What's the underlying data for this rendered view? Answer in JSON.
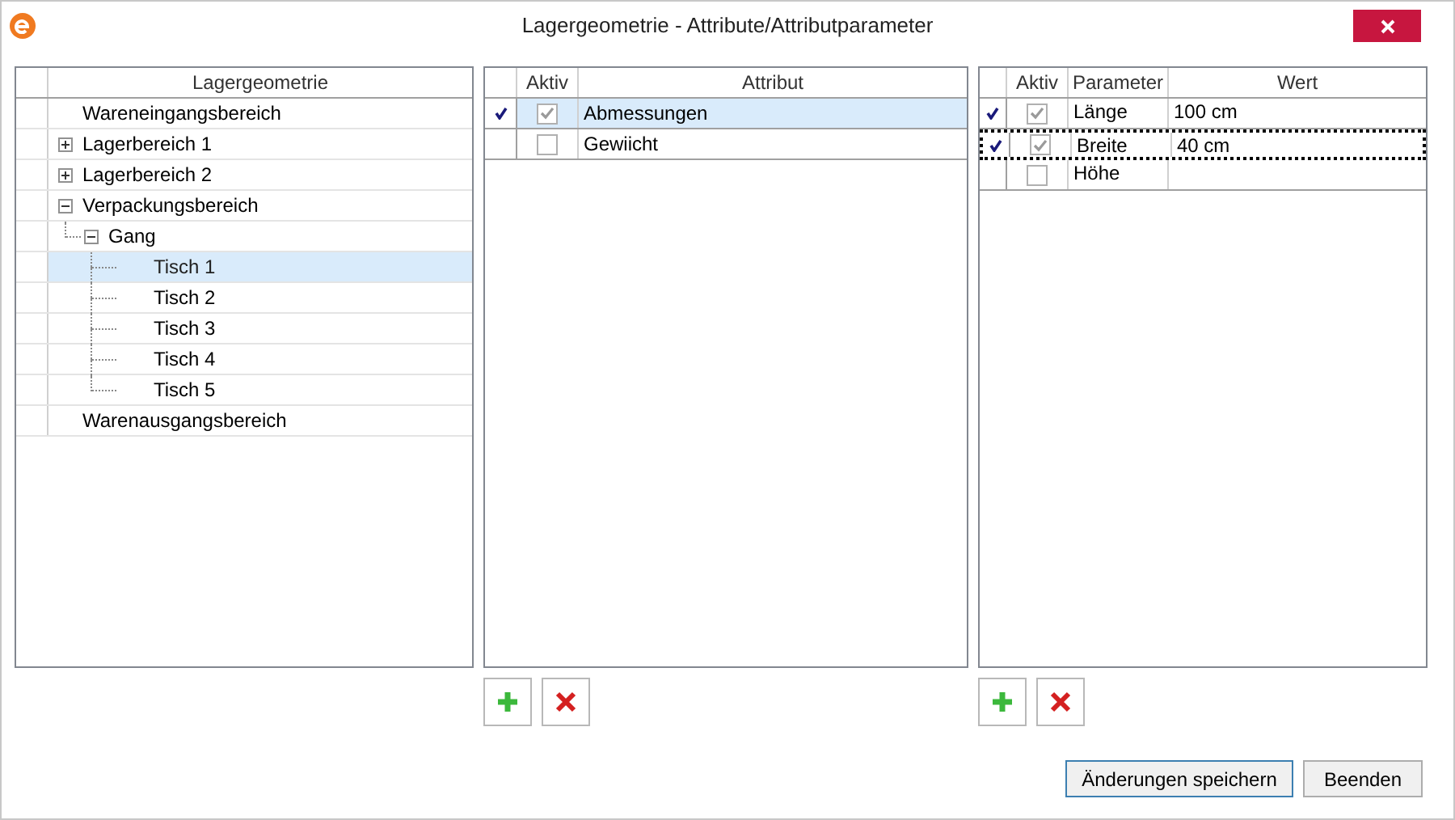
{
  "window": {
    "title": "Lagergeometrie - Attribute/Attributparameter"
  },
  "tree": {
    "header": "Lagergeometrie",
    "items": [
      {
        "label": "Wareneingangsbereich",
        "selected": false
      },
      {
        "label": "Lagerbereich 1",
        "selected": false,
        "expanded": false
      },
      {
        "label": "Lagerbereich 2",
        "selected": false,
        "expanded": false
      },
      {
        "label": "Verpackungsbereich",
        "selected": false,
        "expanded": true,
        "children": [
          {
            "label": "Gang",
            "selected": false,
            "expanded": true,
            "children": [
              {
                "label": "Tisch 1",
                "selected": true
              },
              {
                "label": "Tisch 2",
                "selected": false
              },
              {
                "label": "Tisch 3",
                "selected": false
              },
              {
                "label": "Tisch 4",
                "selected": false
              },
              {
                "label": "Tisch 5",
                "selected": false
              }
            ]
          }
        ]
      },
      {
        "label": "Warenausgangsbereich",
        "selected": false
      }
    ]
  },
  "attributes": {
    "columns": [
      "Aktiv",
      "Attribut"
    ],
    "rows": [
      {
        "current": true,
        "active": true,
        "name": "Abmessungen",
        "selected": true
      },
      {
        "current": false,
        "active": false,
        "name": "Gewiicht",
        "selected": false
      }
    ]
  },
  "parameters": {
    "columns": [
      "Aktiv",
      "Parameter",
      "Wert"
    ],
    "rows": [
      {
        "current": true,
        "active": true,
        "name": "Länge",
        "value": "100 cm",
        "focused": false
      },
      {
        "current": true,
        "active": true,
        "name": "Breite",
        "value": "40 cm",
        "focused": true
      },
      {
        "current": false,
        "active": false,
        "name": "Höhe",
        "focused": false
      }
    ]
  },
  "buttons": [
    "Änderungen speichern",
    "Beenden"
  ]
}
